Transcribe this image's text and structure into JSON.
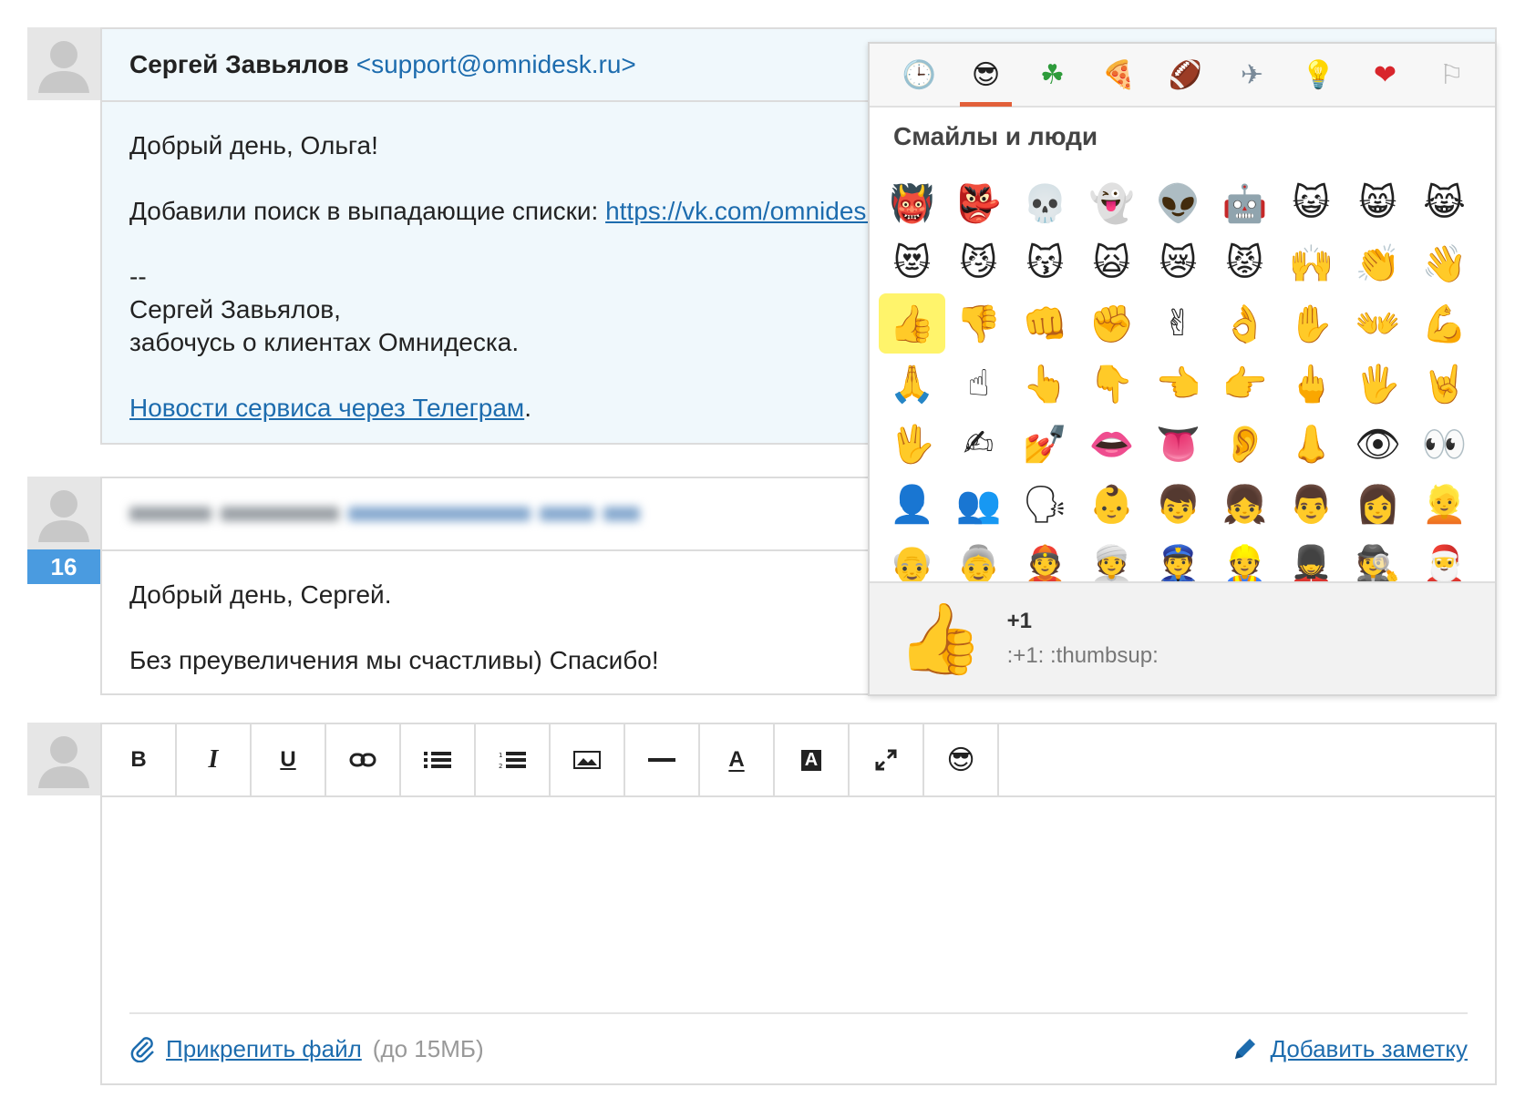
{
  "messages": [
    {
      "sender_name": "Сергей Завьялов",
      "sender_email": "<support@omnidesk.ru>",
      "greeting": "Добрый день, Ольга!",
      "line_prefix": "Добавили поиск в выпадающие списки: ",
      "link": "https://vk.com/omnidesk",
      "sig_dash": "--",
      "sig_name": "Сергей Завьялов,",
      "sig_role": "забочусь о клиентах Омнидеска.",
      "news_link": "Новости сервиса через Телеграм",
      "news_suffix": "."
    },
    {
      "badge": "16",
      "greeting": "Добрый день, Сергей.",
      "line": "Без преувеличения мы счастливы) Спасибо!"
    }
  ],
  "emoji_picker": {
    "tabs": [
      {
        "icon": "clock-icon",
        "glyph": "🕒"
      },
      {
        "icon": "smiley-icon",
        "glyph": "😎"
      },
      {
        "icon": "nature-icon",
        "glyph": "☘"
      },
      {
        "icon": "food-icon",
        "glyph": "🍕"
      },
      {
        "icon": "activity-icon",
        "glyph": "🏈"
      },
      {
        "icon": "travel-icon",
        "glyph": "✈"
      },
      {
        "icon": "objects-icon",
        "glyph": "💡"
      },
      {
        "icon": "symbols-icon",
        "glyph": "❤"
      },
      {
        "icon": "flags-icon",
        "glyph": "⚐"
      }
    ],
    "category_title": "Смайлы и люди",
    "emojis": [
      "👹",
      "👺",
      "💀",
      "👻",
      "👽",
      "🤖",
      "😺",
      "😸",
      "😹",
      "😻",
      "😼",
      "😽",
      "🙀",
      "😿",
      "😾",
      "🙌",
      "👏",
      "👋",
      "👍",
      "👎",
      "👊",
      "✊",
      "✌",
      "👌",
      "✋",
      "👐",
      "💪",
      "🙏",
      "☝",
      "👆",
      "👇",
      "👈",
      "👉",
      "🖕",
      "🖐",
      "🤘",
      "🖖",
      "✍",
      "💅",
      "👄",
      "👅",
      "👂",
      "👃",
      "👁",
      "👀",
      "👤",
      "👥",
      "🗣",
      "👶",
      "👦",
      "👧",
      "👨",
      "👩",
      "👱",
      "👴",
      "👵",
      "👲",
      "👳",
      "👮",
      "👷",
      "💂",
      "🕵",
      "🎅"
    ],
    "selected_index": 18,
    "preview": {
      "glyph": "👍",
      "name": "+1",
      "code": ":+1: :thumbsup:"
    }
  },
  "editor": {
    "toolbar": [
      {
        "name": "bold-button",
        "label": "B"
      },
      {
        "name": "italic-button",
        "label": "I"
      },
      {
        "name": "underline-button",
        "label": "U"
      },
      {
        "name": "link-button",
        "icon": "link-icon"
      },
      {
        "name": "bullet-list-button",
        "icon": "bullet-list-icon"
      },
      {
        "name": "numbered-list-button",
        "icon": "numbered-list-icon"
      },
      {
        "name": "image-button",
        "icon": "image-icon"
      },
      {
        "name": "horizontal-rule-button",
        "icon": "hr-icon"
      },
      {
        "name": "text-color-button",
        "label": "A"
      },
      {
        "name": "background-color-button",
        "label": "A"
      },
      {
        "name": "fullscreen-button",
        "icon": "expand-icon"
      },
      {
        "name": "emoji-button",
        "label": "😎"
      }
    ],
    "attach_label": "Прикрепить файл",
    "attach_hint": "(до 15МБ)",
    "note_label": "Добавить заметку"
  }
}
